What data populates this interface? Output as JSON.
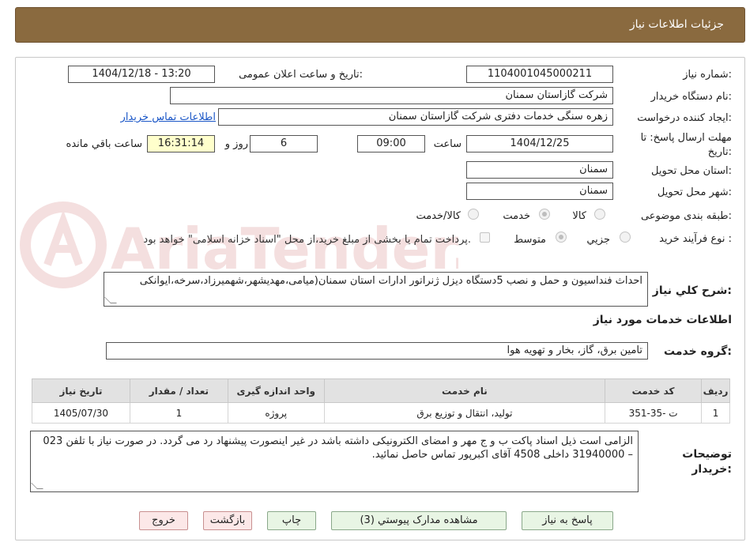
{
  "header": {
    "title": "جزئیات اطلاعات نیاز"
  },
  "fields": {
    "need_number_label": "شماره نیاز:",
    "need_number": "1104001045000211",
    "announce_label": "تاریخ و ساعت اعلان عمومی:",
    "announce_value": "1404/12/18 - 13:20",
    "buyer_org_label": "نام دستگاه خریدار:",
    "buyer_org": "شرکت گازاستان سمنان",
    "creator_label": "ایجاد کننده درخواست:",
    "creator": "زهره سنگی خدمات دفتری شرکت گازاستان سمنان",
    "contact_link": "اطلاعات تماس خریدار",
    "deadline_label": "مهلت ارسال پاسخ: تا تاریخ:",
    "deadline_date": "1404/12/25",
    "time_label": "ساعت",
    "deadline_time": "09:00",
    "days_value": "6",
    "days_label": "روز و",
    "remaining_time": "16:31:14",
    "remaining_label": "ساعت باقي مانده",
    "province_label": "استان محل تحویل:",
    "province": "سمنان",
    "city_label": "شهر محل تحویل:",
    "city": "سمنان",
    "category_label": "طبقه بندی موضوعی:",
    "category_options": [
      "کالا",
      "خدمت",
      "کالا/خدمت"
    ],
    "process_label": "نوع فرآیند خرید :",
    "process_options": [
      "جزیي",
      "متوسط"
    ],
    "payment_note": "پرداخت تمام یا بخشی از مبلغ خرید،از محل \"اسناد خزانه اسلامی\" خواهد بود.",
    "description_label": "شرح کلي نیاز:",
    "description": "احداث فنداسیون و حمل و نصب  5دستگاه دیزل ژنراتور ادارات استان سمنان(میامی،مهدیشهر،شهمیرزاد،سرخه،ایوانکی",
    "services_title": "اطلاعات خدمات مورد نیاز",
    "service_group_label": "گروه خدمت:",
    "service_group": "تامین برق، گاز، بخار و تهویه هوا",
    "buyer_notes_label": "توضیحات خریدار:",
    "buyer_notes": "الزامی است ذیل اسناد پاکت ب و ج مهر و امضای الکترونیکی داشته باشد در غیر اینصورت پیشنهاد رد می گردد. در صورت نیاز با تلفن 023 – 31940000  داخلی 4508  آقای اکبرپور تماس حاصل نمائید."
  },
  "table": {
    "headers": [
      "ردیف",
      "کد خدمت",
      "نام خدمت",
      "واحد اندازه گیری",
      "تعداد / مقدار",
      "تاریخ نیاز"
    ],
    "rows": [
      [
        "1",
        "ت -35-351",
        "تولید، انتقال و توزیع برق",
        "پروژه",
        "1",
        "1405/07/30"
      ]
    ]
  },
  "buttons": {
    "reply": "پاسخ به نیاز",
    "attachments": "مشاهده مدارک پیوستي (3)",
    "print": "چاپ",
    "back": "بازگشت",
    "exit": "خروج"
  },
  "watermark": {
    "text": "AriaTender.neT"
  },
  "colors": {
    "header_bg": "#8a6a3f",
    "link": "#1a56c7",
    "button_green": "#e8f5e4",
    "button_pink": "#fce8e8"
  }
}
